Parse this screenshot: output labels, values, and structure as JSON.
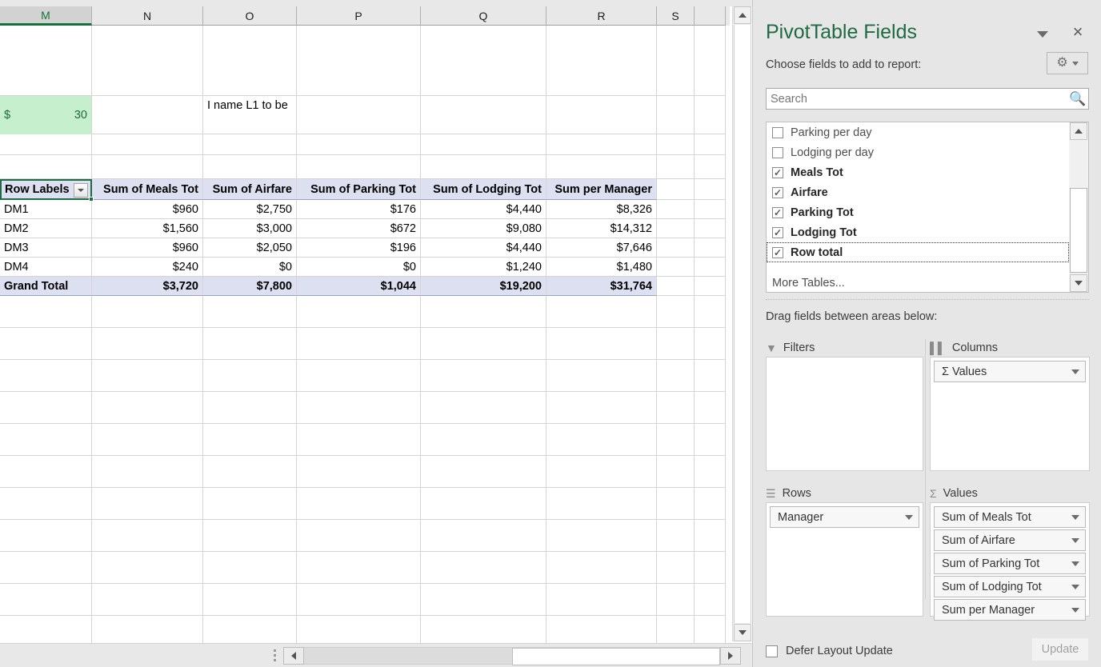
{
  "grid": {
    "column_headers": [
      "M",
      "N",
      "O",
      "P",
      "Q",
      "R",
      "S"
    ],
    "selected_column": "M",
    "notes": {
      "green_cell_currency": "$",
      "green_cell_value": "30",
      "comment_text": "I name L1 to be"
    },
    "pivot": {
      "row_labels_header": "Row Labels",
      "headers": [
        "Sum of Meals Tot",
        "Sum of Airfare",
        "Sum of Parking Tot",
        "Sum of Lodging Tot",
        "Sum per Manager"
      ],
      "rows": [
        {
          "label": "DM1",
          "values": [
            "$960",
            "$2,750",
            "$176",
            "$4,440",
            "$8,326"
          ]
        },
        {
          "label": "DM2",
          "values": [
            "$1,560",
            "$3,000",
            "$672",
            "$9,080",
            "$14,312"
          ]
        },
        {
          "label": "DM3",
          "values": [
            "$960",
            "$2,050",
            "$196",
            "$4,440",
            "$7,646"
          ]
        },
        {
          "label": "DM4",
          "values": [
            "$240",
            "$0",
            "$0",
            "$1,240",
            "$1,480"
          ]
        }
      ],
      "grand_total": {
        "label": "Grand Total",
        "values": [
          "$3,720",
          "$7,800",
          "$1,044",
          "$19,200",
          "$31,764"
        ]
      }
    }
  },
  "panel": {
    "title": "PivotTable Fields",
    "collapse_label": "",
    "close_label": "×",
    "choose_fields_label": "Choose fields to add to report:",
    "gear_glyph": "⚙",
    "search": {
      "placeholder": "Search",
      "value": ""
    },
    "fields": [
      {
        "label": "Parking per day",
        "checked": false,
        "focused": false
      },
      {
        "label": "Lodging per day",
        "checked": false,
        "focused": false
      },
      {
        "label": "Meals Tot",
        "checked": true,
        "focused": false
      },
      {
        "label": "Airfare",
        "checked": true,
        "focused": false
      },
      {
        "label": "Parking Tot",
        "checked": true,
        "focused": false
      },
      {
        "label": "Lodging Tot",
        "checked": true,
        "focused": false
      },
      {
        "label": "Row total",
        "checked": true,
        "focused": true
      }
    ],
    "more_tables_label": "More Tables...",
    "drag_label": "Drag fields between areas below:",
    "areas": {
      "filters": {
        "title": "Filters",
        "icon": "filter-icon",
        "items": []
      },
      "columns": {
        "title": "Columns",
        "icon": "columns-icon",
        "items": [
          "Σ Values"
        ]
      },
      "rows": {
        "title": "Rows",
        "icon": "rows-icon",
        "items": [
          "Manager"
        ]
      },
      "values": {
        "title": "Values",
        "icon": "sigma-icon",
        "items": [
          "Sum of Meals Tot",
          "Sum of Airfare",
          "Sum of Parking Tot",
          "Sum of Lodging Tot",
          "Sum per Manager"
        ]
      }
    },
    "defer_label": "Defer Layout Update",
    "update_label": "Update"
  }
}
